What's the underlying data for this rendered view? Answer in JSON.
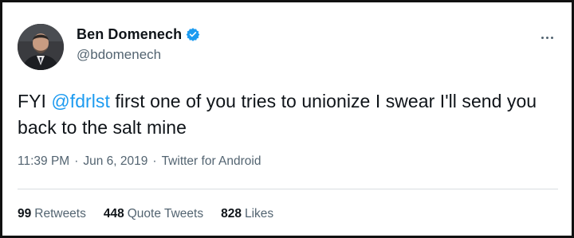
{
  "author": {
    "display_name": "Ben Domenech",
    "handle": "@bdomenech",
    "verified": true,
    "avatar_icon": "profile-photo"
  },
  "tweet": {
    "text_before": "FYI ",
    "mention": "@fdrlst",
    "text_after": " first one of you tries to unionize I swear I'll send you back to the salt mine"
  },
  "meta": {
    "time": "11:39 PM",
    "separator": "·",
    "date": "Jun 6, 2019",
    "source": "Twitter for Android"
  },
  "stats": {
    "retweets_count": "99",
    "retweets_label": "Retweets",
    "quotes_count": "448",
    "quotes_label": "Quote Tweets",
    "likes_count": "828",
    "likes_label": "Likes"
  },
  "colors": {
    "accent": "#1d9bf0",
    "secondary_text": "#536471",
    "primary_text": "#0f1419"
  }
}
